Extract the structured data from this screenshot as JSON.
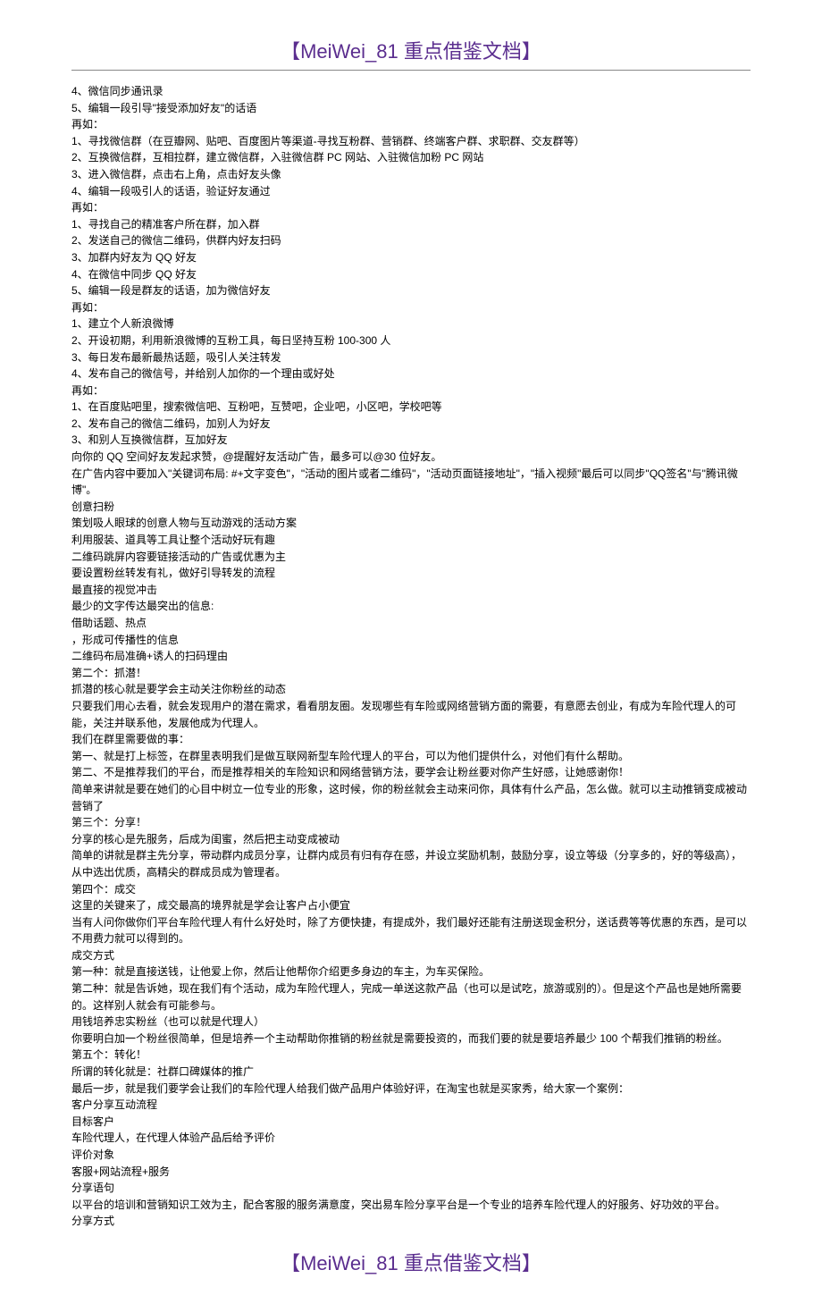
{
  "header": "【MeiWei_81 重点借鉴文档】",
  "footer": "【MeiWei_81 重点借鉴文档】",
  "lines": [
    "4、微信同步通讯录",
    "5、编辑一段引导\"接受添加好友\"的话语",
    "再如：",
    "1、寻找微信群（在豆瓣网、贴吧、百度图片等渠道-寻找互粉群、营销群、终端客户群、求职群、交友群等）",
    "2、互换微信群，互相拉群，建立微信群，入驻微信群 PC 网站、入驻微信加粉 PC 网站",
    "3、进入微信群，点击右上角，点击好友头像",
    "4、编辑一段吸引人的话语，验证好友通过",
    "再如：",
    "1、寻找自己的精准客户所在群，加入群",
    "2、发送自己的微信二维码，供群内好友扫码",
    "3、加群内好友为 QQ 好友",
    "4、在微信中同步 QQ 好友",
    "5、编辑一段是群友的话语，加为微信好友",
    "再如：",
    "1、建立个人新浪微博",
    "2、开设初期，利用新浪微博的互粉工具，每日坚持互粉 100-300 人",
    "3、每日发布最新最热话题，吸引人关注转发",
    "4、发布自己的微信号，并给别人加你的一个理由或好处",
    "再如：",
    "1、在百度贴吧里，搜索微信吧、互粉吧，互赞吧，企业吧，小区吧，学校吧等",
    "2、发布自己的微信二维码，加别人为好友",
    "3、和别人互换微信群，互加好友",
    "向你的 QQ 空间好友发起求赞，@提醒好友活动广告，最多可以@30 位好友。",
    "在广告内容中要加入\"关键词布局: #+文字变色\"，\"活动的图片或者二维码\"，\"活动页面链接地址\"，\"插入视频\"最后可以同步\"QQ签名\"与\"腾讯微博\"。",
    "创意扫粉",
    "策划吸人眼球的创意人物与互动游戏的活动方案",
    "利用服装、道具等工具让整个活动好玩有趣",
    "二维码跳屏内容要链接活动的广告或优惠为主",
    "要设置粉丝转发有礼，做好引导转发的流程",
    "最直接的视觉冲击",
    "最少的文字传达最突出的信息:",
    "借助话题、热点",
    "，形成可传播性的信息",
    "二维码布局准确+诱人的扫码理由",
    "第二个：抓潜！",
    "抓潜的核心就是要学会主动关注你粉丝的动态",
    "只要我们用心去看，就会发现用户的潜在需求，看看朋友圈。发现哪些有车险或网络营销方面的需要，有意愿去创业，有成为车险代理人的可能，关注并联系他，发展他成为代理人。",
    "我们在群里需要做的事：",
    "第一、就是打上标签，在群里表明我们是做互联网新型车险代理人的平台，可以为他们提供什么，对他们有什么帮助。",
    "第二、不是推荐我们的平台，而是推荐相关的车险知识和网络营销方法，要学会让粉丝要对你产生好感，让她感谢你！",
    "简单来讲就是要在她们的心目中树立一位专业的形象，这时候，你的粉丝就会主动来问你，具体有什么产品，怎么做。就可以主动推销变成被动营销了",
    "第三个：分享！",
    "分享的核心是先服务，后成为闺蜜，然后把主动变成被动",
    "简单的讲就是群主先分享，带动群内成员分享，让群内成员有归有存在感，并设立奖励机制，鼓励分享，设立等级（分享多的，好的等级高），从中选出优质，高精尖的群成员成为管理者。",
    "第四个：成交",
    "这里的关键来了，成交最高的境界就是学会让客户占小便宜",
    "当有人问你做你们平台车险代理人有什么好处时，除了方便快捷，有提成外，我们最好还能有注册送现金积分，送话费等等优惠的东西，是可以不用费力就可以得到的。",
    "成交方式",
    "第一种：就是直接送钱，让他爱上你，然后让他帮你介绍更多身边的车主，为车买保险。",
    "第二种：就是告诉她，现在我们有个活动，成为车险代理人，完成一单送这款产品（也可以是试吃，旅游或别的）。但是这个产品也是她所需要的。这样别人就会有可能参与。",
    "用钱培养忠实粉丝（也可以就是代理人）",
    "你要明白加一个粉丝很简单，但是培养一个主动帮助你推销的粉丝就是需要投资的，而我们要的就是要培养最少 100 个帮我们推销的粉丝。",
    "第五个：转化！",
    "所谓的转化就是：社群口碑媒体的推广",
    "最后一步，就是我们要学会让我们的车险代理人给我们做产品用户体验好评，在淘宝也就是买家秀，给大家一个案例：",
    "客户分享互动流程",
    "目标客户",
    "车险代理人，在代理人体验产品后给予评价",
    "评价对象",
    "客服+网站流程+服务",
    "分享语句",
    "以平台的培训和营销知识工效为主，配合客服的服务满意度，突出易车险分享平台是一个专业的培养车险代理人的好服务、好功效的平台。",
    "分享方式"
  ]
}
